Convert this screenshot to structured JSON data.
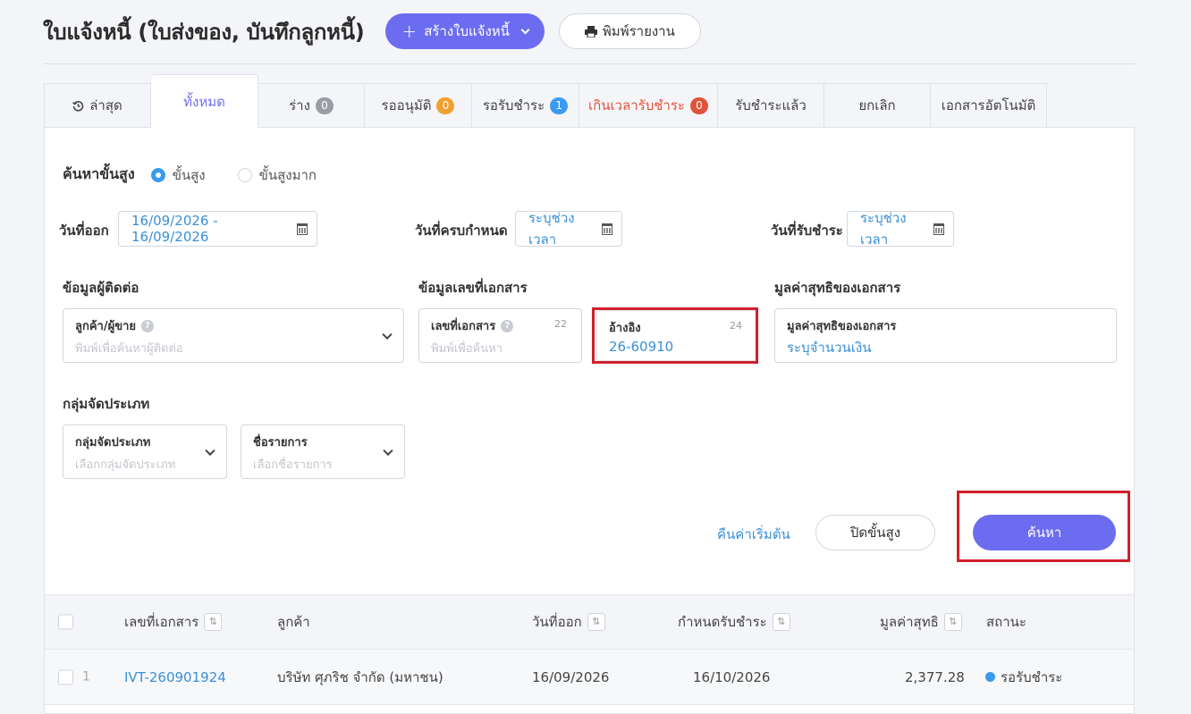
{
  "header": {
    "title": "ใบแจ้งหนี้ (ใบส่งของ, บันทึกลูกหนี้)",
    "create_label": "สร้างใบแจ้งหนี้",
    "print_label": "พิมพ์รายงาน"
  },
  "tabs": [
    {
      "label": "ล่าสุด",
      "badge": null,
      "icon": "history-icon"
    },
    {
      "label": "ทั้งหมด",
      "badge": null,
      "active": true
    },
    {
      "label": "ร่าง",
      "badge": "0",
      "badge_color": "#9a9ca3"
    },
    {
      "label": "รออนุมัติ",
      "badge": "0",
      "badge_color": "#f0a030"
    },
    {
      "label": "รอรับชำระ",
      "badge": "1",
      "badge_color": "#3a9bef"
    },
    {
      "label": "เกินเวลารับชำระ",
      "badge": "0",
      "badge_color": "#e0533a"
    },
    {
      "label": "รับชำระแล้ว",
      "badge": null
    },
    {
      "label": "ยกเลิก",
      "badge": null
    },
    {
      "label": "เอกสารอัตโนมัติ",
      "badge": null
    }
  ],
  "search": {
    "title": "ค้นหาขั้นสูง",
    "mode_advanced": "ขั้นสูง",
    "mode_very_advanced": "ขั้นสูงมาก",
    "issue_date_label": "วันที่ออก",
    "issue_date_value": "16/09/2026 - 16/09/2026",
    "due_date_label": "วันที่ครบกำหนด",
    "due_date_value": "ระบุช่วงเวลา",
    "paid_date_label": "วันที่รับชำระ",
    "paid_date_value": "ระบุช่วงเวลา",
    "contact_section": "ข้อมูลผู้ติดต่อ",
    "contact_field_label": "ลูกค้า/ผู้ขาย",
    "contact_field_placeholder": "พิมพ์เพื่อค้นหาผู้ติดต่อ",
    "doc_section": "ข้อมูลเลขที่เอกสาร",
    "doc_no_label": "เลขที่เอกสาร",
    "doc_no_placeholder": "พิมพ์เพื่อค้นหา",
    "doc_no_count": "22",
    "ref_label": "อ้างอิง",
    "ref_value": "26-60910",
    "ref_count": "24",
    "amount_section": "มูลค่าสุทธิของเอกสาร",
    "amount_field_label": "มูลค่าสุทธิของเอกสาร",
    "amount_field_value": "ระบุจำนวนเงิน",
    "group_section": "กลุ่มจัดประเภท",
    "group_field_label": "กลุ่มจัดประเภท",
    "group_field_placeholder": "เลือกกลุ่มจัดประเภท",
    "item_field_label": "ชื่อรายการ",
    "item_field_placeholder": "เลือกชื่อรายการ",
    "reset_label": "คืนค่าเริ่มต้น",
    "close_label": "ปิดขั้นสูง",
    "search_label": "ค้นหา"
  },
  "table": {
    "columns": [
      "เลขที่เอกสาร",
      "ลูกค้า",
      "วันที่ออก",
      "กำหนดรับชำระ",
      "มูลค่าสุทธิ",
      "สถานะ"
    ],
    "rows": [
      {
        "index": "1",
        "doc_no": "IVT-260901924",
        "customer": "บริษัท ศุภริช จำกัด (มหาชน)",
        "issue_date": "16/09/2026",
        "due_date": "16/10/2026",
        "amount": "2,377.28",
        "status": "รอรับชำระ",
        "status_color": "#3a9bef"
      }
    ]
  }
}
